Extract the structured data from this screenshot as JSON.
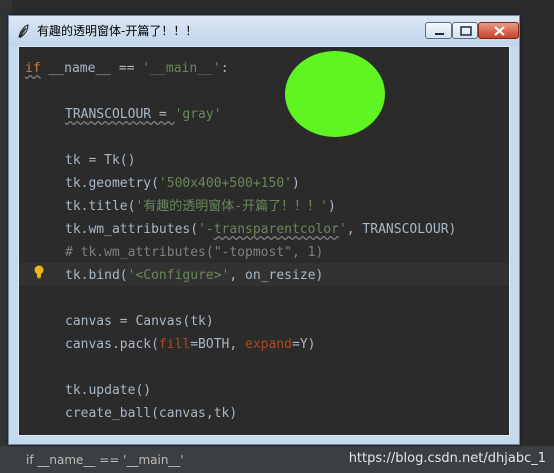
{
  "window": {
    "title": "有趣的透明窗体-开篇了！！！"
  },
  "statusbar": {
    "breadcrumb": "if __name__ == '__main__'",
    "watermark": "https://blog.csdn.net/dhjabc_1"
  },
  "colors": {
    "ball": "#5ff522",
    "editor_bg": "#2b2b2b",
    "keyword": "#cc7832",
    "string": "#6a8759",
    "comment": "#808080"
  },
  "code": {
    "l1_kw": "if",
    "l1_name": " __name__ == ",
    "l1_str": "'__main__'",
    "l1_end": ":",
    "l3_a": "TRANSCOLOUR = ",
    "l3_str": "'gray'",
    "l5": "tk = Tk()",
    "l6_a": "tk.geometry(",
    "l6_str": "'500x400+500+150'",
    "l6_end": ")",
    "l7_a": "tk.title(",
    "l7_str": "'有趣的透明窗体-开篇了！！！'",
    "l7_end": ")",
    "l8_a": "tk.wm_attributes(",
    "l8_q1": "'-",
    "l8_sq": "transparentcolor",
    "l8_q2": "'",
    "l8_end": ", TRANSCOLOUR)",
    "l9": "# tk.wm_attributes(\"-topmost\", 1)",
    "l10_a": "tk.bind(",
    "l10_str": "'<Configure>'",
    "l10_end": ", on_resize)",
    "l12": "canvas = Canvas(tk)",
    "l13_a": "canvas.pack(",
    "l13_p1": "fill",
    "l13_b": "=BOTH, ",
    "l13_p2": "expand",
    "l13_end": "=Y)",
    "l15": "tk.update()",
    "l16": "create_ball(canvas,tk)"
  },
  "icons": {
    "title": "feather-icon",
    "bulb": "lightbulb-icon"
  }
}
